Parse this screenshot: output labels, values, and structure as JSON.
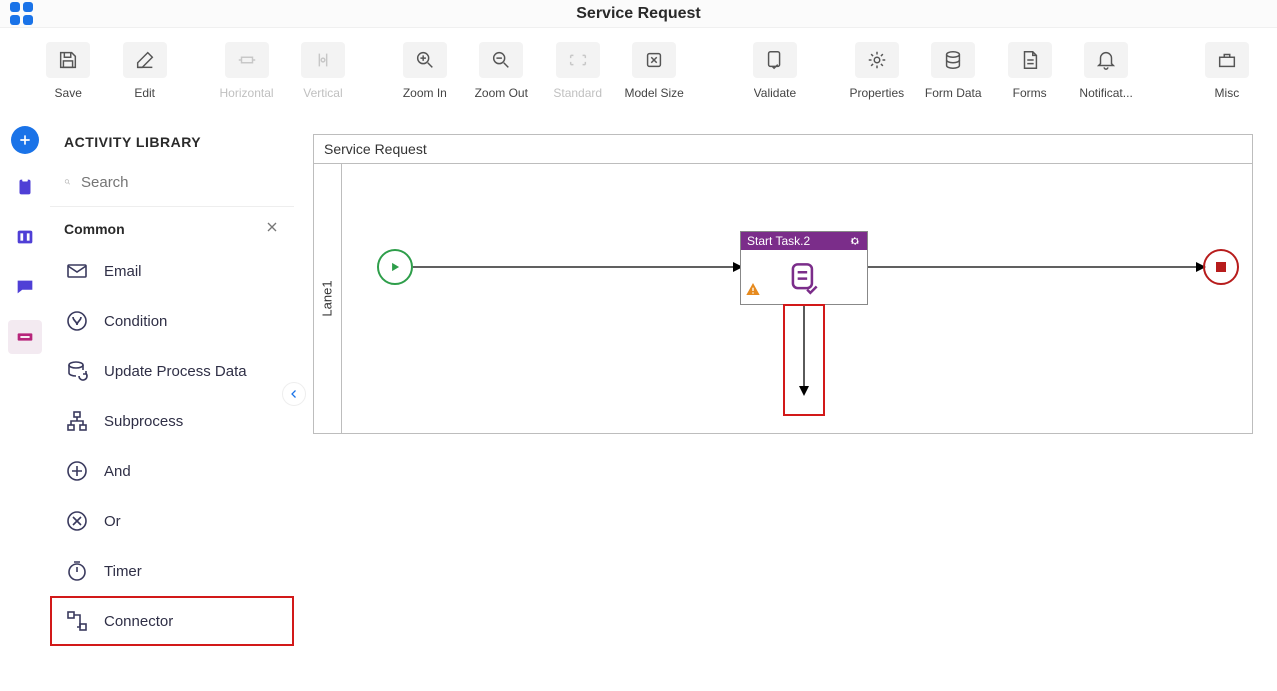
{
  "topbar": {
    "title": "Service Request"
  },
  "toolbar": {
    "save": "Save",
    "edit": "Edit",
    "horizontal": "Horizontal",
    "vertical": "Vertical",
    "zoom_in": "Zoom In",
    "zoom_out": "Zoom Out",
    "standard": "Standard",
    "model_size": "Model Size",
    "validate": "Validate",
    "properties": "Properties",
    "form_data": "Form Data",
    "forms": "Forms",
    "notifications": "Notificat...",
    "misc": "Misc"
  },
  "library": {
    "title": "ACTIVITY LIBRARY",
    "search_placeholder": "Search",
    "section": "Common",
    "items": {
      "email": "Email",
      "condition": "Condition",
      "update_process_data": "Update Process Data",
      "subprocess": "Subprocess",
      "and": "And",
      "or": "Or",
      "timer": "Timer",
      "connector": "Connector"
    }
  },
  "canvas": {
    "title": "Service Request",
    "lane": "Lane1",
    "task_label": "Start Task.2"
  }
}
